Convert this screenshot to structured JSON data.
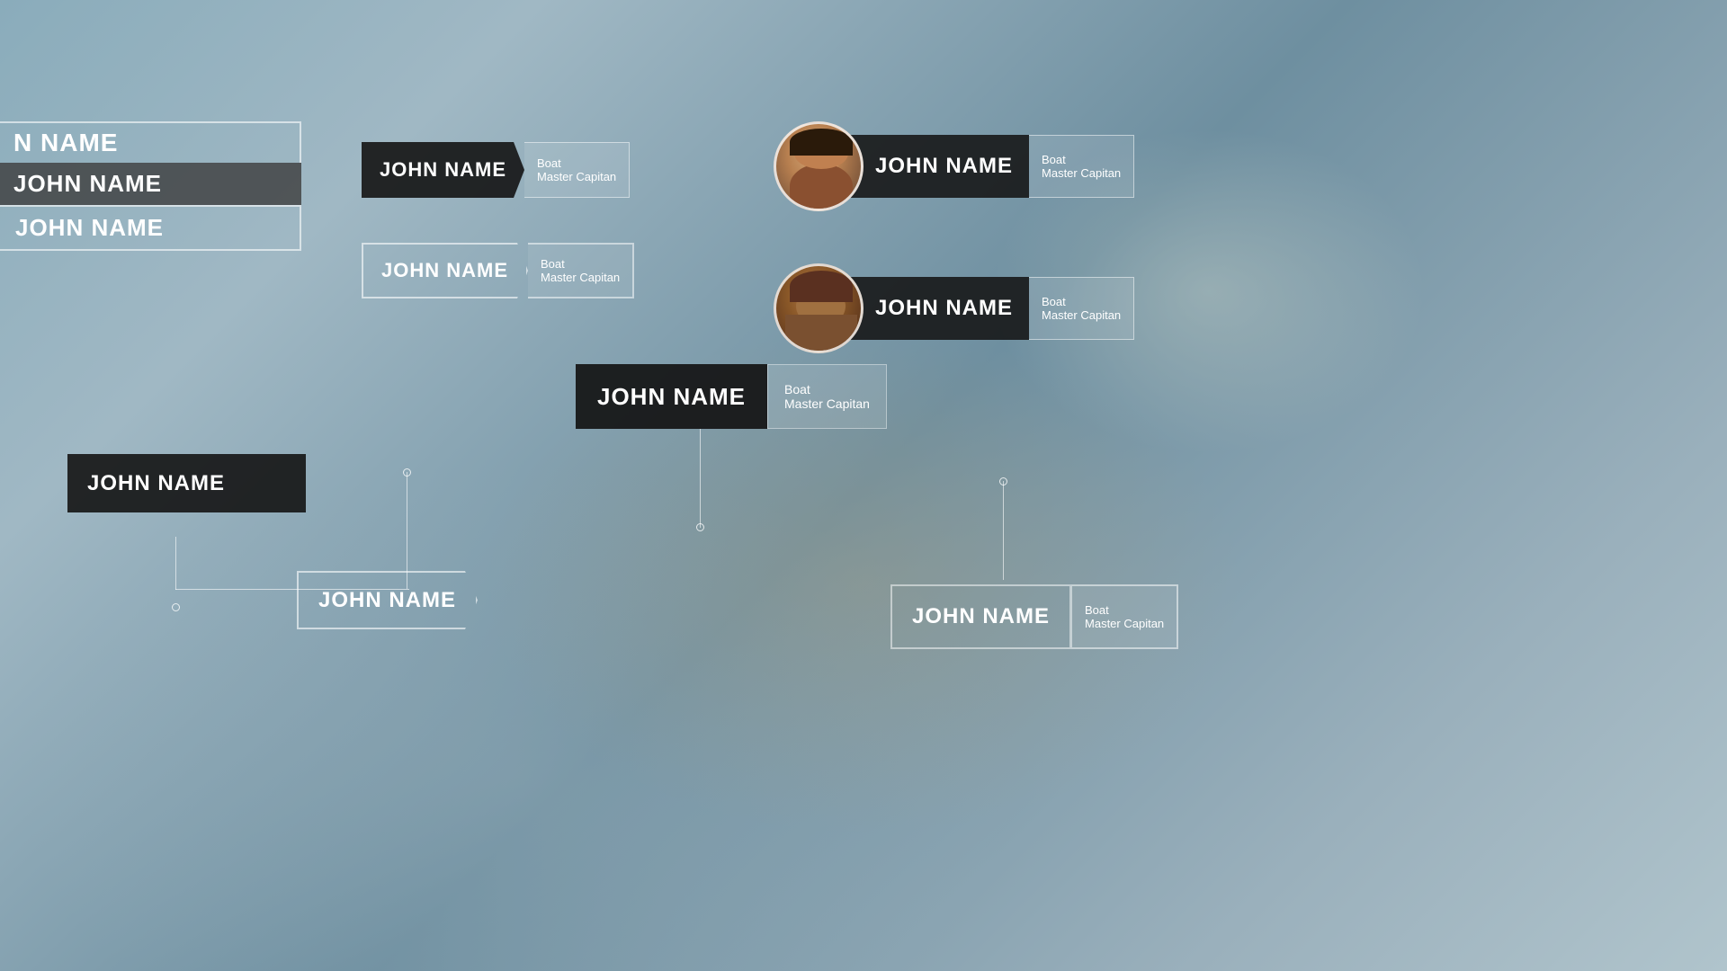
{
  "background": {
    "description": "Blurred beach scene with people"
  },
  "cards": {
    "partial_top_left": {
      "row1": "N NAME",
      "row2": "JOHN NAME",
      "row3": "JOHN NAME"
    },
    "card1": {
      "name": "JOHN NAME",
      "line1": "Boat",
      "line2": "Master Capitan"
    },
    "card2": {
      "name": "JOHN NAME",
      "line1": "Boat",
      "line2": "Master Capitan"
    },
    "card3": {
      "name": "JOHN NAME",
      "line1": "Boat",
      "line2": "Master Capitan",
      "has_avatar": true,
      "avatar_type": "woman"
    },
    "card4": {
      "name": "JOHN NAME",
      "line1": "Boat",
      "line2": "Master Capitan",
      "has_avatar": true,
      "avatar_type": "man"
    },
    "card5": {
      "name": "JOHN NAME",
      "line1": "Boat",
      "line2": "Master Capitan"
    },
    "card6": {
      "name": "JOHN NAME"
    },
    "card7": {
      "name": "JOHN NAME"
    },
    "card8": {
      "name": "JOHN NAME",
      "line1": "Boat",
      "line2": "Master Capitan"
    }
  }
}
